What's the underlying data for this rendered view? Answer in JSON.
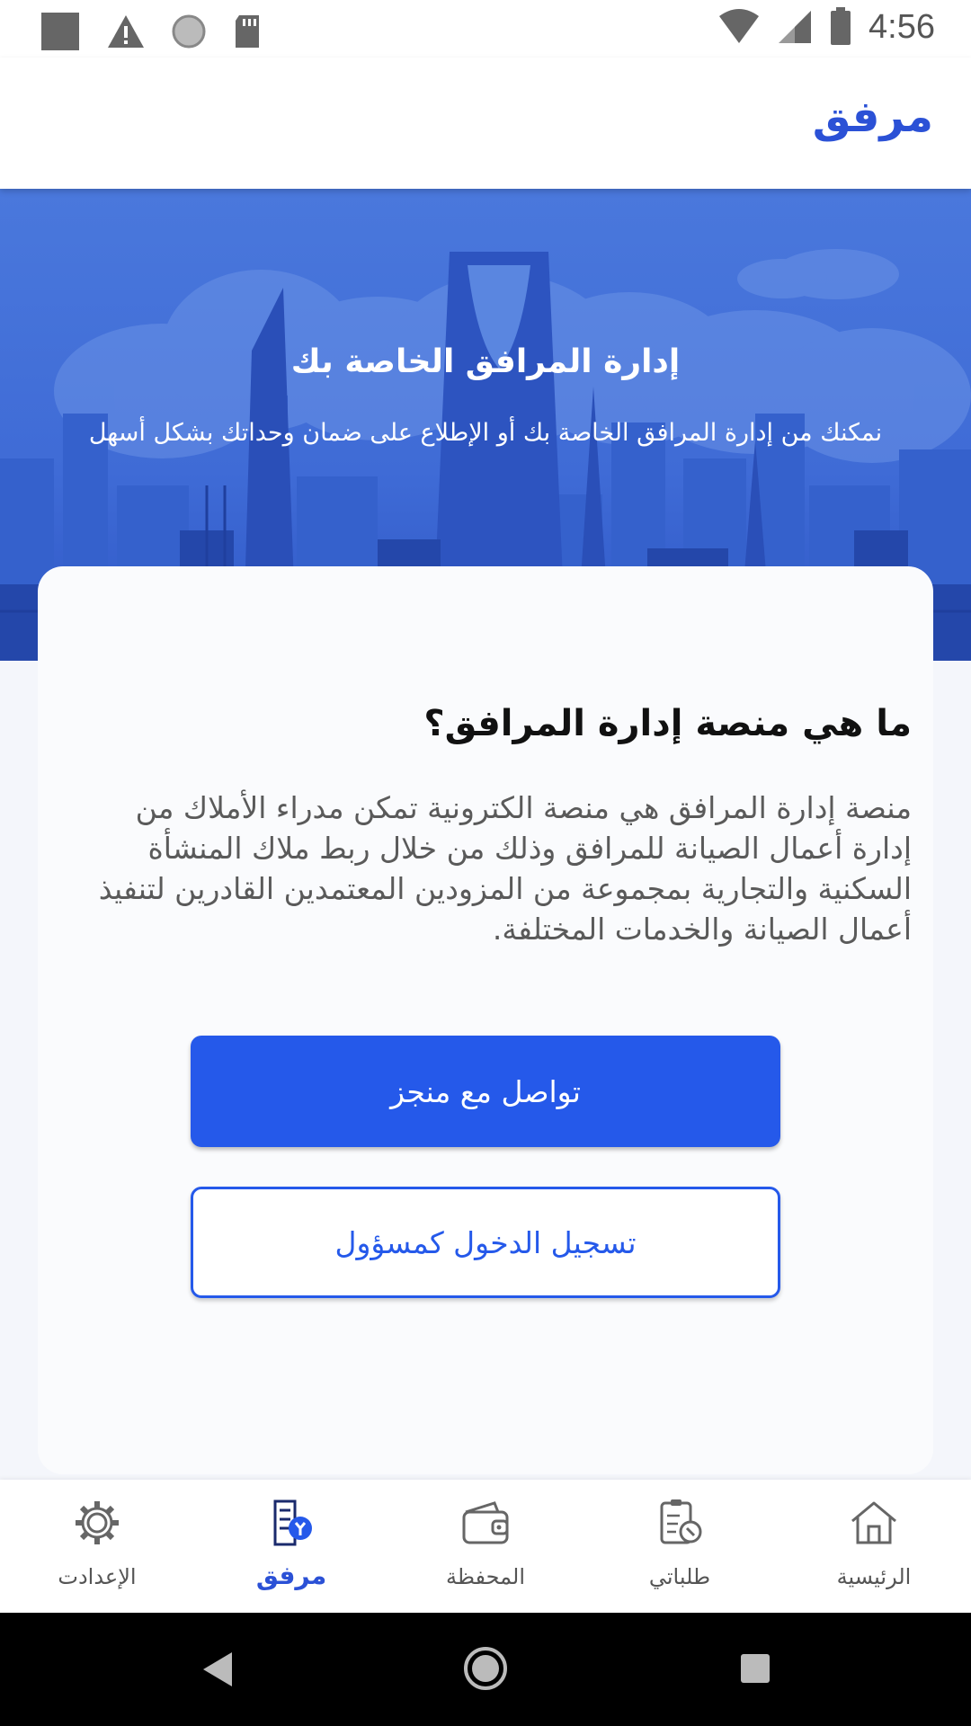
{
  "status_bar": {
    "time": "4:56"
  },
  "app_bar": {
    "title": "مرفق"
  },
  "hero": {
    "title": "إدارة المرافق الخاصة بك",
    "subtitle": "نمكنك من إدارة المرافق الخاصة بك أو الإطلاع على ضمان وحداتك بشكل أسهل"
  },
  "card": {
    "heading": "ما هي منصة إدارة المرافق؟",
    "body": "منصة إدارة المرافق هي منصة الكترونية تمكن مدراء الأملاك من إدارة أعمال الصيانة للمرافق وذلك من خلال ربط ملاك المنشأة السكنية والتجارية بمجموعة من المزودين المعتمدين القادرين لتنفيذ أعمال الصيانة والخدمات المختلفة.",
    "primary_button": "تواصل مع منجز",
    "secondary_button": "تسجيل الدخول كمسؤول"
  },
  "bottom_nav": {
    "items": [
      {
        "label": "الإعدادت",
        "icon": "settings-icon"
      },
      {
        "label": "مرفق",
        "icon": "facility-icon",
        "active": true
      },
      {
        "label": "المحفظة",
        "icon": "wallet-icon"
      },
      {
        "label": "طلباتي",
        "icon": "requests-icon"
      },
      {
        "label": "الرئيسية",
        "icon": "home-icon"
      }
    ]
  },
  "colors": {
    "brand": "#2559ea",
    "title": "#2b51d6",
    "hero": "#4a78dc"
  }
}
